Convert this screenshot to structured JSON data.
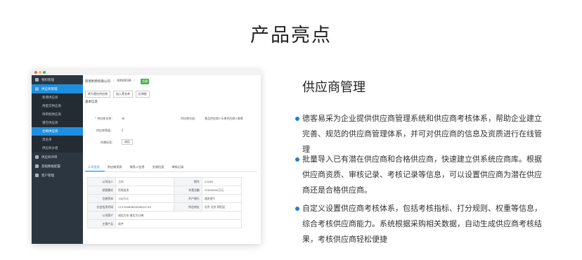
{
  "page": {
    "title": "产品亮点"
  },
  "mock": {
    "sidebar": {
      "items": [
        {
          "label": "物料管理"
        },
        {
          "label": "供应商管理"
        },
        {
          "label": "新增供应商"
        },
        {
          "label": "待提交供应商"
        },
        {
          "label": "待审批供应商"
        },
        {
          "label": "潜在供应商"
        },
        {
          "label": "合格供应商"
        },
        {
          "label": "黑名单"
        },
        {
          "label": "供应商分组"
        },
        {
          "label": "供应商评审"
        },
        {
          "label": "基础数据配置"
        },
        {
          "label": "客户管理"
        }
      ]
    },
    "header": {
      "company": "阿彻利特有限公司",
      "code": "0000036",
      "status": "合格"
    },
    "buttons": {
      "b1": "转为潜在供应商",
      "b2": "加入黑名单",
      "b3": "反审批"
    },
    "section": "基本信息",
    "form": {
      "name_label": "供应商名称：",
      "name_value": "wl",
      "group_label": "供应商分组：",
      "group_value": "食品供应商>水果供应商>香蕉",
      "level_label": "供应商等级：",
      "level_value": "2",
      "tag_label": "所属标签：",
      "tag_value": "诚信"
    },
    "tabs": [
      "公司信息",
      "供应商资质",
      "联系人信息",
      "交易信息",
      "审核记录"
    ],
    "table": [
      [
        "公司法人",
        "王科",
        "税号",
        "23265"
      ],
      [
        "经营模式",
        "贸易批发",
        "年营业额",
        "25000000万元"
      ],
      [
        "注册资本",
        "100万元",
        "开户银行",
        "浦发银行"
      ],
      [
        "社会信用代码",
        "2123568989569854745",
        "所在地址",
        "北京 北京 朝阳区"
      ],
      [
        "公司简介",
        "诚信为本 事实为口碑",
        "",
        ""
      ],
      [
        "主营产品",
        "软件",
        "",
        ""
      ]
    ]
  },
  "feature": {
    "title": "供应商管理",
    "bullets": [
      "德客易采为企业提供供应商管理系统和供应商考核体系，帮助企业建立完善、规范的供应商管理体系，并可对供应商的信息及资质进行在线管理",
      "批量导入已有潜在供应商和合格供应商，快速建立供系统应商库。根据供应商资质、审核记录、考核记录等信息，可以设置供应商为潜在供应商还是合格供应商。",
      "自定义设置供应商考核体系，包括考核指标、打分规则、权重等信息，综合考核供应商能力。系统根据采购相关数据，自动生成供应商考核结果，考核供应商轻松便捷"
    ]
  },
  "colors": {
    "accent": "#1e8fe0",
    "sidebar": "#2c3640",
    "bullet": "#1e7fd8",
    "ok": "#4cb050"
  }
}
